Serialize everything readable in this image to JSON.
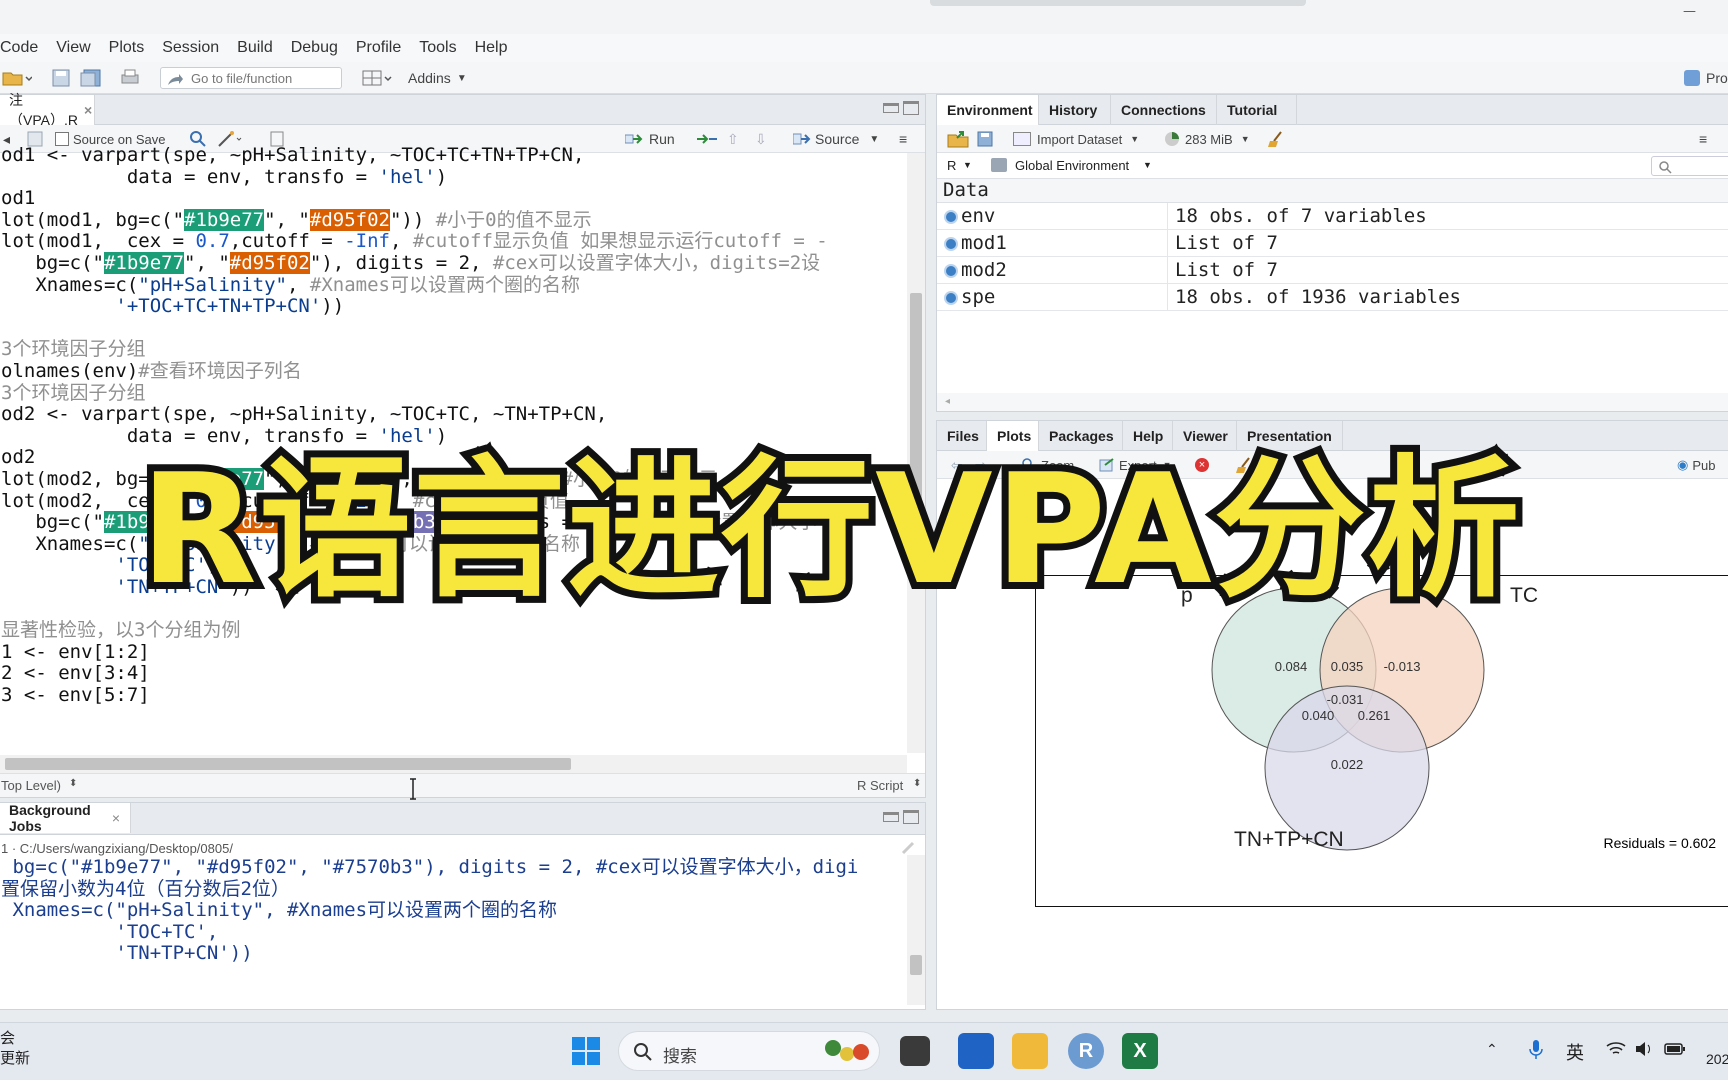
{
  "menu": [
    "Code",
    "View",
    "Plots",
    "Session",
    "Build",
    "Debug",
    "Profile",
    "Tools",
    "Help"
  ],
  "toolbar": {
    "goto_placeholder": "Go to file/function",
    "addins_label": "Addins",
    "project_label": "Pro"
  },
  "editor": {
    "tab_label": "注（VPA）.R",
    "source_on_save": "Source on Save",
    "run_label": "Run",
    "source_label": "Source",
    "status_scope": "Top Level)",
    "status_type": "R Script",
    "lines": [
      "od1 <- varpart(spe, ~pH+Salinity, ~TOC+TC+TN+TP+CN,",
      "           data = env, transfo = 'hel')",
      "od1",
      "lot(mod1, bg=c(\"#1b9e77\", \"#d95f02\")) #小于0的值不显示",
      "lot(mod1,  cex = 0.7,cutoff = -Inf, #cutoff显示负值 如果想显示运行cutoff = -",
      "   bg=c(\"#1b9e77\", \"#d95f02\"), digits = 2, #cex可以设置字体大小，digits=2设",
      "   Xnames=c(\"pH+Salinity\", #Xnames可以设置两个圈的名称",
      "          '+TOC+TC+TN+TP+CN'))",
      "",
      "3个环境因子分组",
      "olnames(env)#查看环境因子列名",
      "3个环境因子分组",
      "od2 <- varpart(spe, ~pH+Salinity, ~TOC+TC, ~TN+TP+CN,",
      "           data = env, transfo = 'hel')",
      "od2",
      "lot(mod2, bg=c(\"#1b9e77\", \"#d95f02\", \"#7570b3\")) #小于0的值不显示",
      "lot(mod2,  cex = 0.7,cutoff = -Inf, #cutoff显示负值",
      "   bg=c(\"#1b9e77\", \"#d95f02\", \"#7570b3\"), digits = 2, #cex可以设置字体大小",
      "   Xnames=c(\"pH+Salinity\", #Xnames可以设置两个圈的名称",
      "          'TOC+TC',",
      "          'TN+TP+CN'))",
      "",
      "显著性检验，以3个分组为例",
      "1 <- env[1:2]",
      "2 <- env[3:4]",
      "3 <- env[5:7]"
    ]
  },
  "console": {
    "tab_label": "Background Jobs",
    "path": "1 · C:/Users/wangzixiang/Desktop/0805/",
    "lines": [
      " bg=c(\"#1b9e77\", \"#d95f02\", \"#7570b3\"), digits = 2, #cex可以设置字体大小，digi",
      "置保留小数为4位（百分数后2位）",
      " Xnames=c(\"pH+Salinity\", #Xnames可以设置两个圈的名称",
      "          'TOC+TC',",
      "          'TN+TP+CN'))"
    ]
  },
  "env_pane": {
    "tabs": [
      "Environment",
      "History",
      "Connections",
      "Tutorial"
    ],
    "import_label": "Import Dataset",
    "memory": "283 MiB",
    "lang": "R",
    "scope": "Global Environment",
    "section": "Data",
    "rows": [
      {
        "name": "env",
        "value": "18 obs. of 7 variables"
      },
      {
        "name": "mod1",
        "value": "List of  7"
      },
      {
        "name": "mod2",
        "value": "List of  7"
      },
      {
        "name": "spe",
        "value": "18 obs. of 1936 variables"
      }
    ]
  },
  "files_pane": {
    "tabs": [
      "Files",
      "Plots",
      "Packages",
      "Help",
      "Viewer",
      "Presentation"
    ],
    "zoom_label": "Zoom",
    "export_label": "Export",
    "publish_label": "Pub"
  },
  "chart_data": {
    "type": "venn",
    "sets": [
      "pH+Salinity",
      "TOC+TC",
      "TN+TP+CN"
    ],
    "set_labels_visible": [
      "p",
      "TC",
      "TN+TP+CN"
    ],
    "colors": [
      "#1b9e77",
      "#d95f02",
      "#7570b3"
    ],
    "regions": [
      {
        "sets": [
          "pH+Salinity"
        ],
        "label": "0.084"
      },
      {
        "sets": [
          "pH+Salinity",
          "TOC+TC"
        ],
        "label": "0.035"
      },
      {
        "sets": [
          "TOC+TC"
        ],
        "label": "-0.013"
      },
      {
        "sets": [
          "pH+Salinity",
          "TOC+TC",
          "TN+TP+CN"
        ],
        "label": "-0.031"
      },
      {
        "sets": [
          "pH+Salinity",
          "TN+TP+CN"
        ],
        "label": "0.040"
      },
      {
        "sets": [
          "TOC+TC",
          "TN+TP+CN"
        ],
        "label": "0.261"
      },
      {
        "sets": [
          "TN+TP+CN"
        ],
        "label": "0.022"
      }
    ],
    "residuals_label": "Residuals =  0.602"
  },
  "overlay_title": "R语言进行VPA分析",
  "taskbar": {
    "search_placeholder": "搜索",
    "left_text_1": "会",
    "left_text_2": "更新",
    "ime": "英",
    "clock": "202"
  }
}
